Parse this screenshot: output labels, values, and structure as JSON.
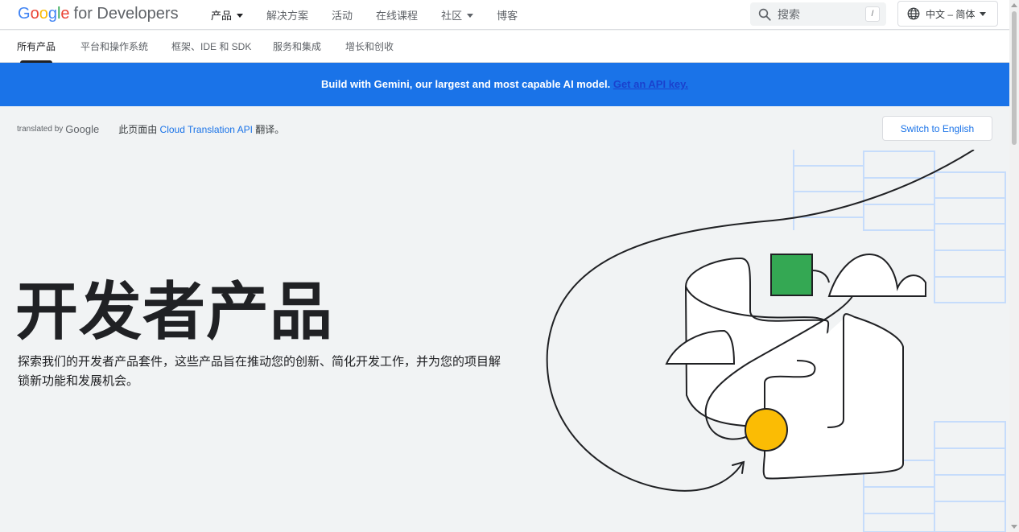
{
  "header": {
    "logo": {
      "g1": "G",
      "g2": "o",
      "g3": "o",
      "g4": "g",
      "g5": "l",
      "g6": "e",
      "suffix": "for Developers"
    },
    "nav": [
      {
        "label": "产品",
        "dropdown": true
      },
      {
        "label": "解决方案"
      },
      {
        "label": "活动"
      },
      {
        "label": "在线课程"
      },
      {
        "label": "社区",
        "dropdown": true
      },
      {
        "label": "博客"
      }
    ],
    "search": {
      "placeholder": "搜索",
      "shortcut": "/"
    },
    "language": {
      "label": "中文 – 简体",
      "icon": "globe-icon"
    }
  },
  "subnav": {
    "tabs": [
      {
        "label": "所有产品"
      },
      {
        "label": "平台和操作系统"
      },
      {
        "label": "框架、IDE 和 SDK"
      },
      {
        "label": "服务和集成"
      },
      {
        "label": "增长和创收"
      }
    ]
  },
  "banner": {
    "text": "Build with Gemini, our largest and most capable AI model.",
    "link": "Get an API key."
  },
  "translation": {
    "by": "translated by",
    "google": "Google",
    "note_prefix": "此页面由",
    "link": "Cloud Translation API",
    "note_suffix": "翻译。",
    "switch_button": "Switch to English"
  },
  "hero": {
    "title": "开发者产品",
    "description": "探索我们的开发者产品套件，这些产品旨在推动您的创新、简化开发工作，并为您的项目解锁新功能和发展机会。"
  },
  "colors": {
    "brand_blue": "#1a73e8",
    "square_green": "#34a853",
    "circle_yellow": "#fbbc04",
    "grid_blue": "#c6dcfb"
  }
}
